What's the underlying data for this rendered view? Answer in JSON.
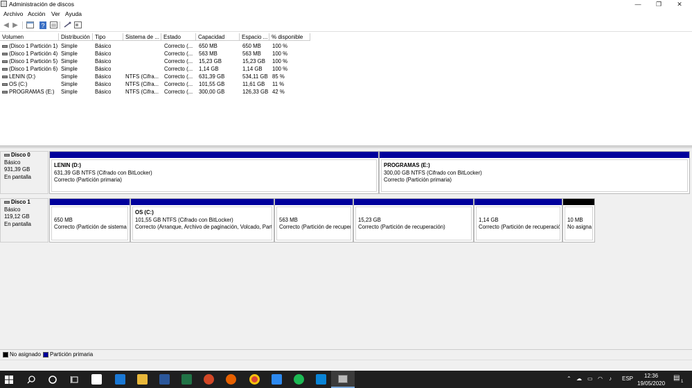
{
  "window": {
    "title": "Administración de discos",
    "controls": {
      "minimize": "—",
      "restore": "❐",
      "close": "✕"
    }
  },
  "menu": {
    "items": [
      "Archivo",
      "Acción",
      "Ver",
      "Ayuda"
    ]
  },
  "toolbar": {
    "icons": [
      "back-icon",
      "forward-icon",
      "properties-icon",
      "help-icon",
      "list-view-icon",
      "connect-icon",
      "disk-view-icon"
    ]
  },
  "volumes": {
    "columns": [
      "Volumen",
      "Distribución",
      "Tipo",
      "Sistema de ...",
      "Estado",
      "Capacidad",
      "Espacio ...",
      "% disponible"
    ],
    "rows": [
      [
        "(Disco 1 Partición 1)",
        "Simple",
        "Básico",
        "",
        "Correcto (...",
        "650 MB",
        "650 MB",
        "100 %"
      ],
      [
        "(Disco 1 Partición 4)",
        "Simple",
        "Básico",
        "",
        "Correcto (...",
        "563 MB",
        "563 MB",
        "100 %"
      ],
      [
        "(Disco 1 Partición 5)",
        "Simple",
        "Básico",
        "",
        "Correcto (...",
        "15,23 GB",
        "15,23 GB",
        "100 %"
      ],
      [
        "(Disco 1 Partición 6)",
        "Simple",
        "Básico",
        "",
        "Correcto (...",
        "1,14 GB",
        "1,14 GB",
        "100 %"
      ],
      [
        "LENIN (D:)",
        "Simple",
        "Básico",
        "NTFS (Cifra...",
        "Correcto (...",
        "631,39 GB",
        "534,11 GB",
        "85 %"
      ],
      [
        "OS (C:)",
        "Simple",
        "Básico",
        "NTFS (Cifra...",
        "Correcto (...",
        "101,55 GB",
        "11,61 GB",
        "11 %"
      ],
      [
        "PROGRAMAS (E:)",
        "Simple",
        "Básico",
        "NTFS (Cifra...",
        "Correcto (...",
        "300,00 GB",
        "126,33 GB",
        "42 %"
      ]
    ]
  },
  "disks": [
    {
      "name": "Disco 0",
      "type": "Básico",
      "size": "931,39 GB",
      "status": "En pantalla",
      "partitions": [
        {
          "title": "LENIN  (D:)",
          "detail": "631,39 GB NTFS (Cifrado con BitLocker)",
          "status": "Correcto (Partición primaria)"
        },
        {
          "title": "PROGRAMAS  (E:)",
          "detail": "300,00 GB NTFS (Cifrado con BitLocker)",
          "status": "Correcto (Partición primaria)"
        }
      ]
    },
    {
      "name": "Disco 1",
      "type": "Básico",
      "size": "119,12 GB",
      "status": "En pantalla",
      "partitions": [
        {
          "title": "",
          "detail": "650 MB",
          "status": "Correcto (Partición de sistema"
        },
        {
          "title": "OS  (C:)",
          "detail": "101,55 GB NTFS (Cifrado con BitLocker)",
          "status": "Correcto (Arranque, Archivo de paginación, Volcado, Parti"
        },
        {
          "title": "",
          "detail": "563 MB",
          "status": "Correcto (Partición de recuper"
        },
        {
          "title": "",
          "detail": "15,23 GB",
          "status": "Correcto (Partición de recuperación)"
        },
        {
          "title": "",
          "detail": "1,14 GB",
          "status": "Correcto (Partición de recuperació"
        },
        {
          "title": "",
          "detail": "10 MB",
          "status": "No asigna"
        }
      ]
    }
  ],
  "legend": {
    "unallocated": "No asignado",
    "unallocated_color": "#000000",
    "primary": "Partición primaria",
    "primary_color": "#00009c"
  },
  "taskbar": {
    "language": "ESP",
    "time": "12:36",
    "date": "19/05/2020",
    "notifications": "1"
  }
}
